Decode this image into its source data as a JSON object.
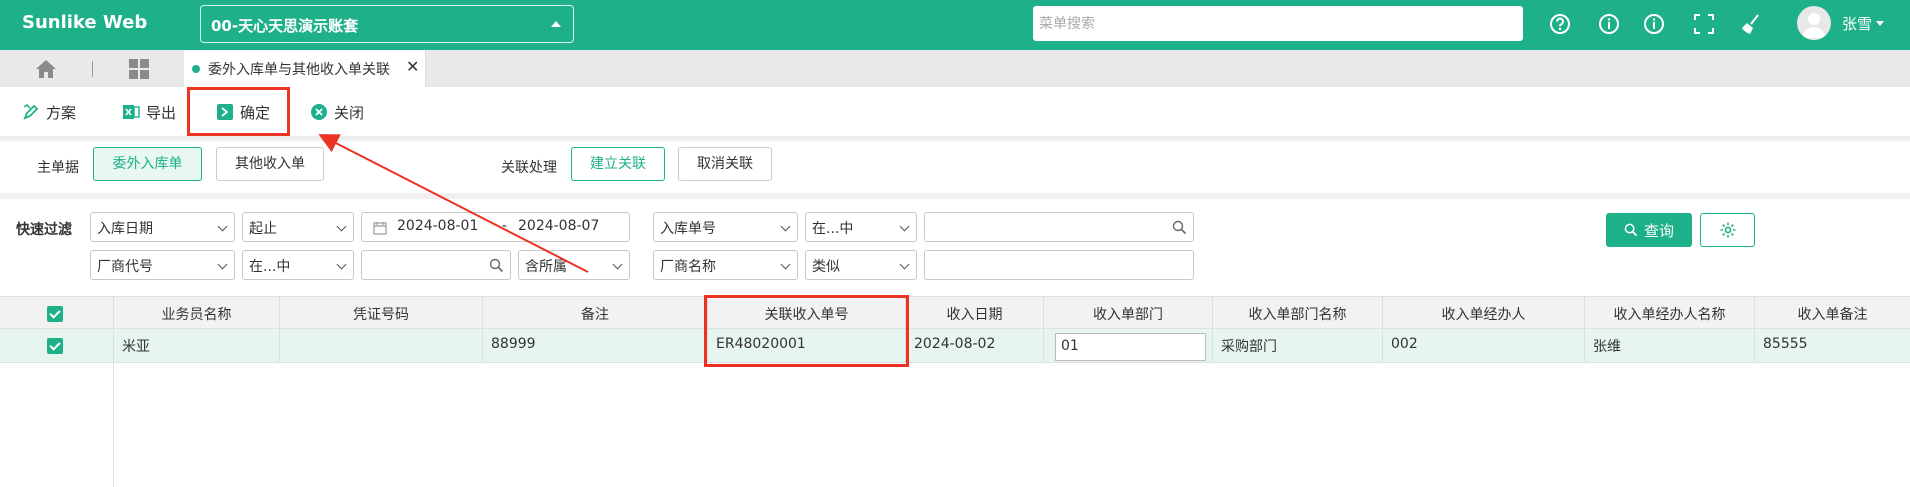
{
  "header": {
    "brand": "Sunlike Web",
    "account": "00-天心天思演示账套",
    "search_placeholder": "菜单搜索",
    "icons": [
      "help-icon",
      "info-icon",
      "info-icon",
      "fullscreen-icon",
      "broom-icon"
    ],
    "user_name": "张雪"
  },
  "tabs": {
    "active_label": "委外入库单与其他收入单关联",
    "close": "✕"
  },
  "toolbar": {
    "scheme": "方案",
    "export": "导出",
    "confirm": "确定",
    "close": "关闭"
  },
  "main": {
    "master_label": "主单据",
    "master_btn_1": "委外入库单",
    "master_btn_2": "其他收入单",
    "link_label": "关联处理",
    "link_btn": "建立关联",
    "unlink_btn": "取消关联"
  },
  "filter": {
    "title": "快速过滤",
    "r1_field": "入库日期",
    "r1_op": "起止",
    "date_from": "2024-08-01",
    "date_sep": "-",
    "date_to": "2024-08-07",
    "r1b_field": "入库单号",
    "r1b_op": "在...中",
    "r2_field": "厂商代号",
    "r2_op": "在...中",
    "r2_scope": "含所属",
    "r2b_field": "厂商名称",
    "r2b_op": "类似",
    "query": "查询"
  },
  "grid": {
    "columns": [
      "业务员名称",
      "凭证号码",
      "备注",
      "关联收入单号",
      "收入日期",
      "收入单部门",
      "收入单部门名称",
      "收入单经办人",
      "收入单经办人名称",
      "收入单备注"
    ],
    "rows": [
      [
        "米亚",
        "",
        "88999",
        "ER48020001",
        "2024-08-02",
        "01",
        "采购部门",
        "002",
        "张维",
        "85555"
      ]
    ]
  },
  "colors": {
    "brand": "#1eb088",
    "highlight": "#ea3323"
  }
}
